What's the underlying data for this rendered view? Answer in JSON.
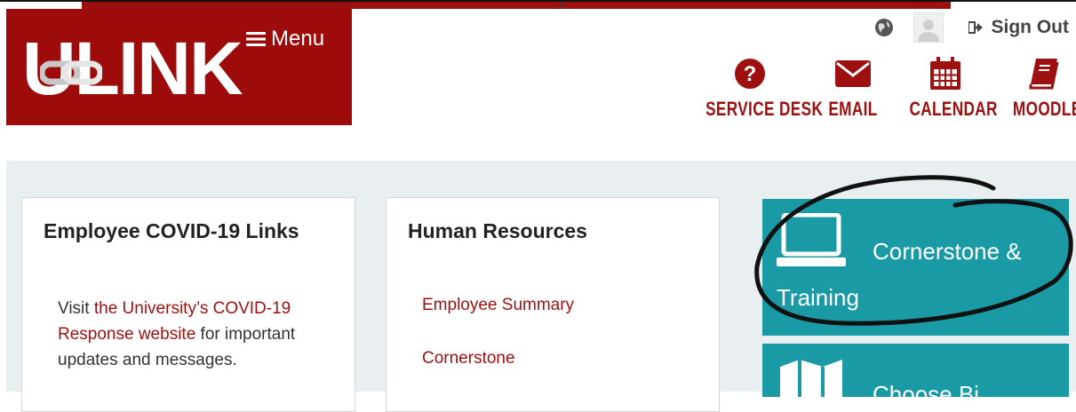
{
  "header": {
    "logo_text": "ULINK",
    "menu_label": "Menu",
    "sign_out_label": "Sign Out"
  },
  "quick_links": [
    {
      "label": "SERVICE DESK",
      "icon": "question-circle-icon"
    },
    {
      "label": "EMAIL",
      "icon": "envelope-icon"
    },
    {
      "label": "CALENDAR",
      "icon": "calendar-icon"
    },
    {
      "label": "MOODLE",
      "icon": "book-icon"
    }
  ],
  "cards": {
    "covid": {
      "title": "Employee COVID-19 Links",
      "text_before": "Visit ",
      "link_text": "the University’s COVID-19 Response website",
      "text_after": " for important updates and messages."
    },
    "hr": {
      "title": "Human Resources",
      "links": [
        "Employee Summary",
        "Cornerstone"
      ]
    }
  },
  "tiles": {
    "cornerstone_line1": "Cornerstone &",
    "cornerstone_line2": "Training",
    "second_partial": "Choose Bi"
  },
  "colors": {
    "brand_red": "#9e0b0b",
    "teal": "#1a9aa5",
    "panel_bg": "#e9eef0"
  }
}
